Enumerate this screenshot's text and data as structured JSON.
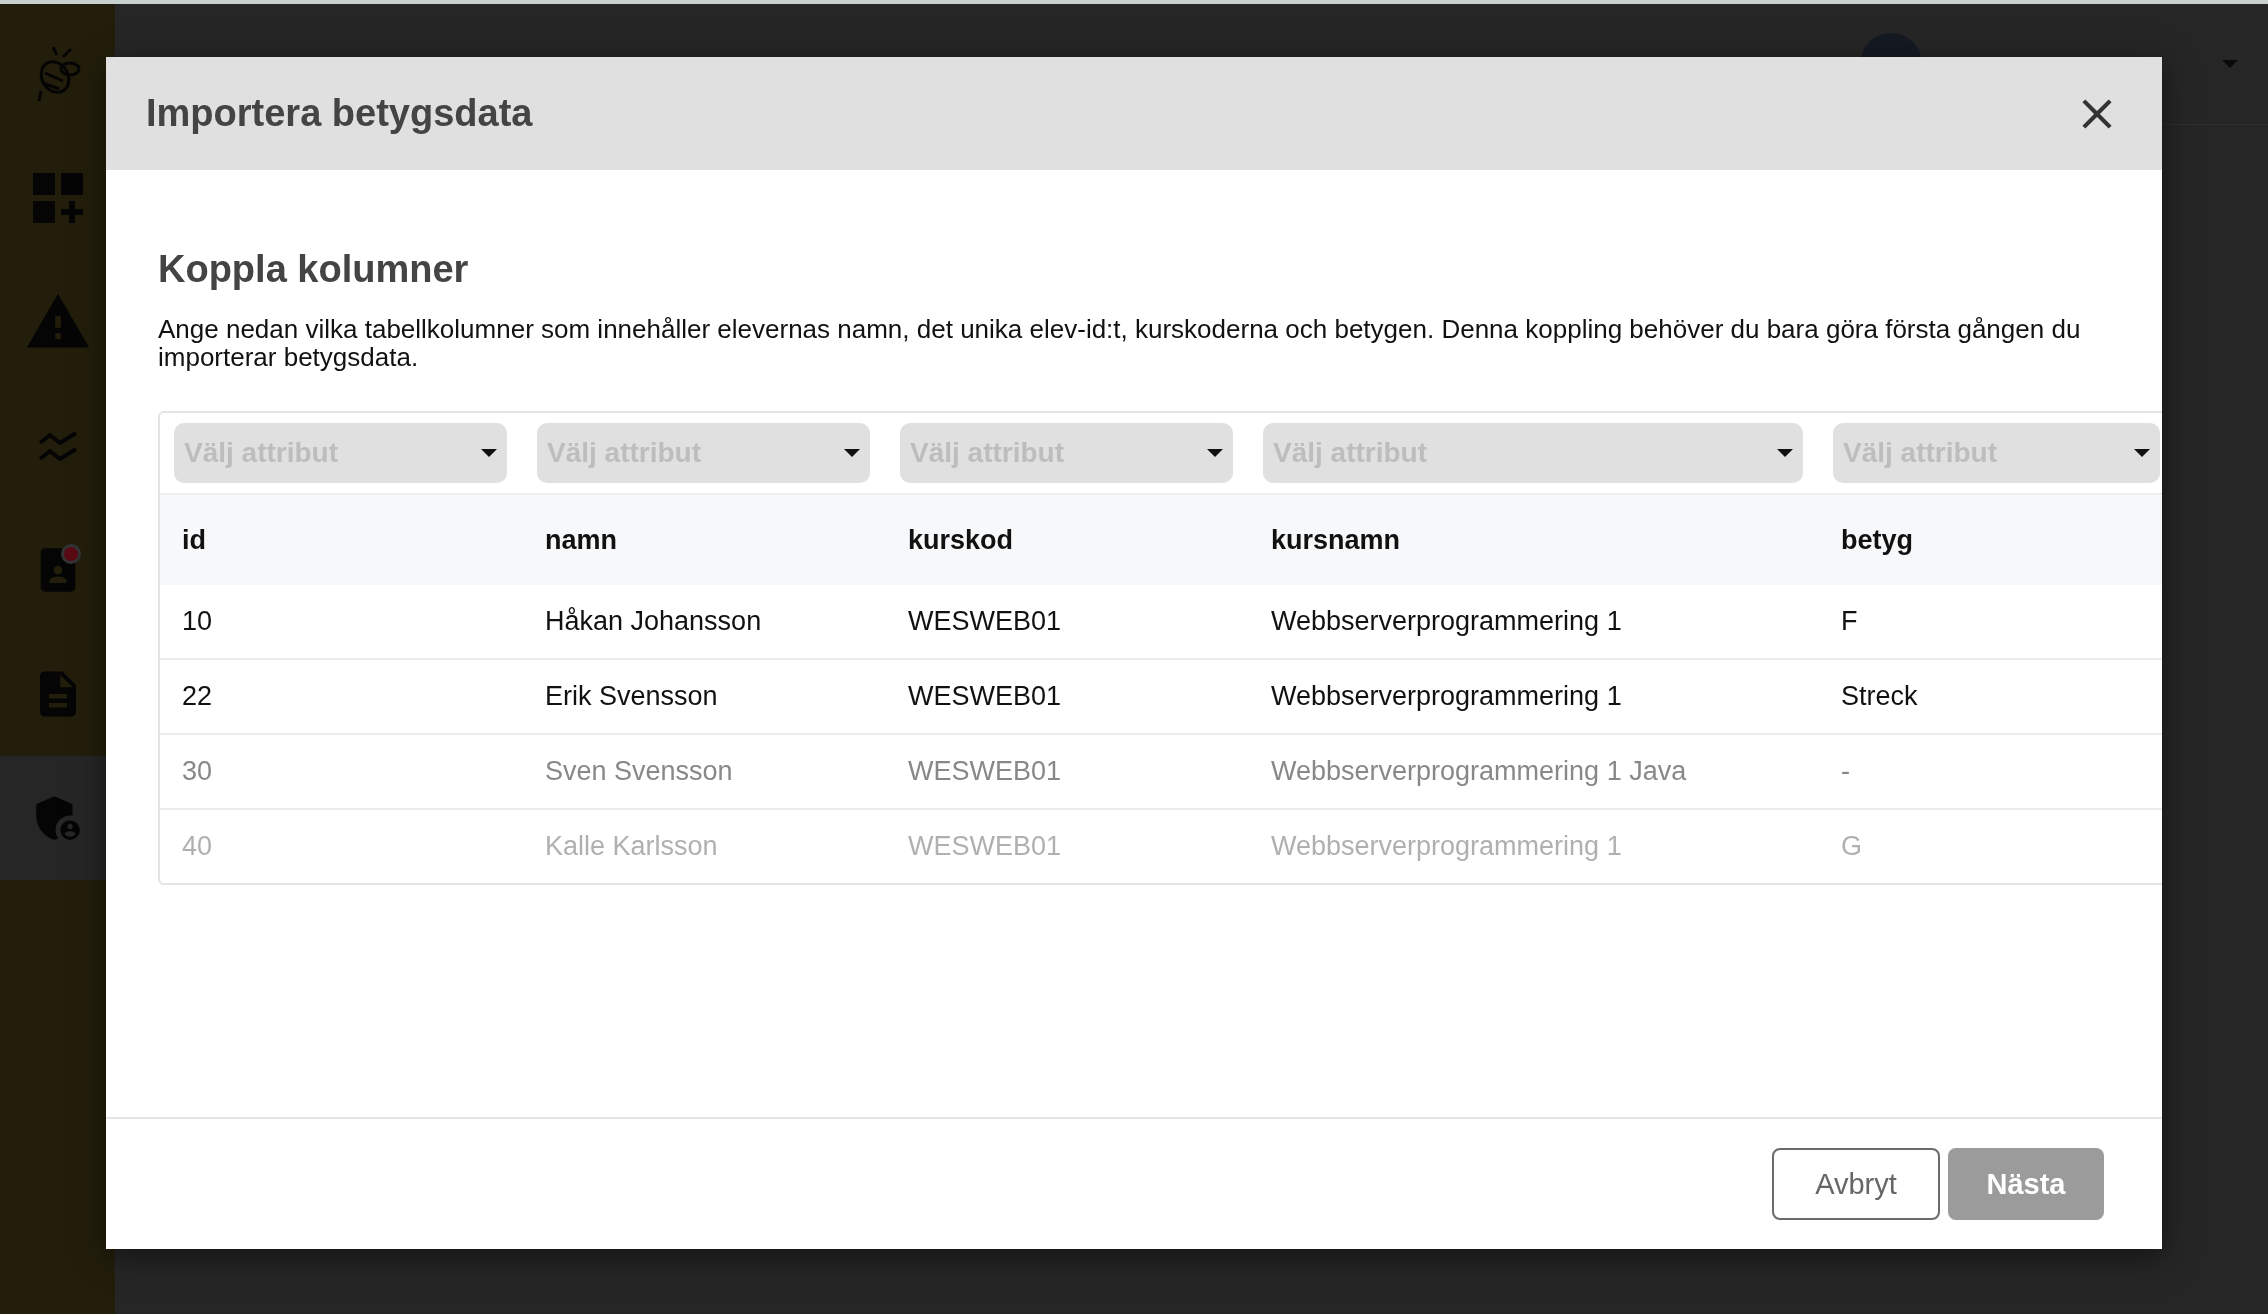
{
  "sidebar": {
    "items": [
      {
        "kind": "logo",
        "selected": false,
        "badge": false
      },
      {
        "kind": "dashboard",
        "selected": false,
        "badge": false
      },
      {
        "kind": "warning",
        "selected": false,
        "badge": false
      },
      {
        "kind": "chart",
        "selected": false,
        "badge": false
      },
      {
        "kind": "contact",
        "selected": false,
        "badge": true
      },
      {
        "kind": "document",
        "selected": false,
        "badge": false
      },
      {
        "kind": "admin",
        "selected": true,
        "badge": false
      }
    ]
  },
  "dialog": {
    "title": "Importera betygsdata",
    "heading": "Koppla kolumner",
    "description": "Ange nedan vilka tabellkolumner som innehåller elevernas namn, det unika elev-id:t, kurskoderna och betygen. Denna koppling behöver du bara göra första gången du importerar betygsdata.",
    "table": {
      "selects": [
        {
          "placeholder": "Välj attribut"
        },
        {
          "placeholder": "Välj attribut"
        },
        {
          "placeholder": "Välj attribut"
        },
        {
          "placeholder": "Välj attribut"
        },
        {
          "placeholder": "Välj attribut"
        }
      ],
      "columns": [
        "id",
        "namn",
        "kurskod",
        "kursnamn",
        "betyg"
      ],
      "rows": [
        {
          "kind": "valid",
          "cells": [
            "10",
            "Håkan Johansson",
            "WESWEB01",
            "Webbserverprogrammering 1",
            "F"
          ]
        },
        {
          "kind": "valid",
          "cells": [
            "22",
            "Erik Svensson",
            "WESWEB01",
            "Webbserverprogrammering 1",
            "Streck"
          ]
        },
        {
          "kind": "partial",
          "cells": [
            "30",
            "Sven Svensson",
            "WESWEB01",
            "Webbserverprogrammering 1 Java",
            "-"
          ]
        },
        {
          "kind": "ignored",
          "cells": [
            "40",
            "Kalle Karlsson",
            "WESWEB01",
            "Webbserverprogrammering 1",
            "G"
          ]
        }
      ]
    },
    "buttons": [
      {
        "kind": "secondary",
        "label": "Avbryt",
        "disabled": false
      },
      {
        "kind": "primary",
        "label": "Nästa",
        "disabled": true
      }
    ]
  }
}
